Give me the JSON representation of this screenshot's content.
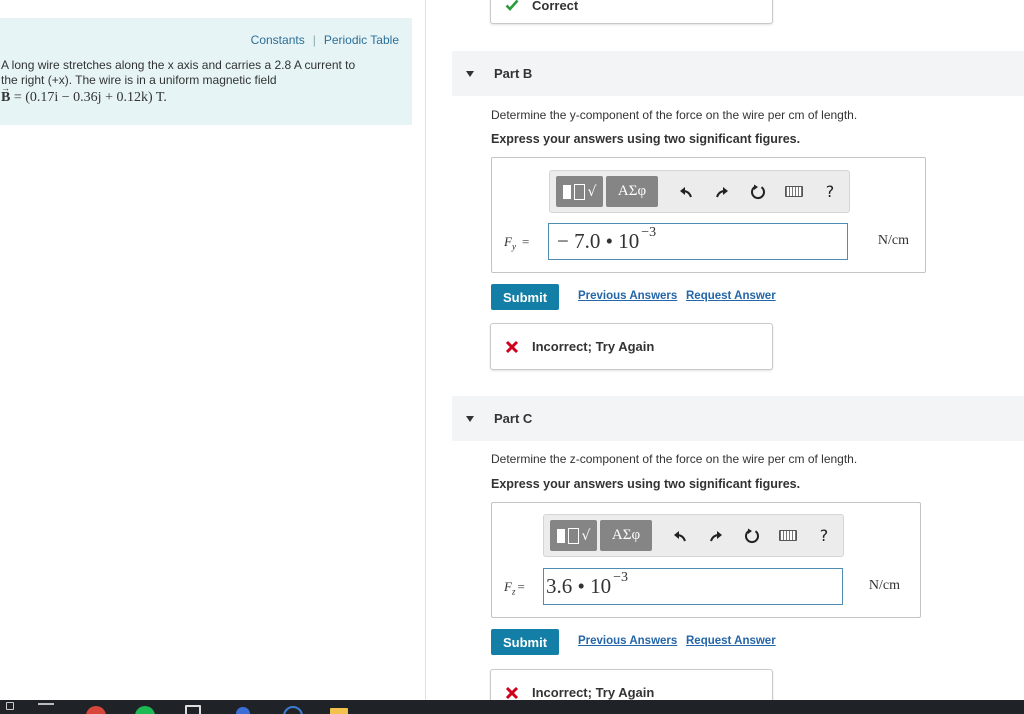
{
  "problem": {
    "links": {
      "constants": "Constants",
      "separator": "|",
      "periodic_table": "Periodic Table"
    },
    "text_line1": "A long wire stretches along the x axis and carries a 2.8 A current to",
    "text_line2": "the right (+x). The wire is in a uniform magnetic field",
    "field_symbol": "B",
    "field_value": " = (0.17i − 0.36j + 0.12k) T."
  },
  "part_a": {
    "feedback": "Correct",
    "feedback_icon": "check-icon",
    "color": "#2a9b3a"
  },
  "part_b": {
    "title": "Part B",
    "question": "Determine the y-component of the force on the wire per cm of length.",
    "instruction": "Express your answers using two significant figures.",
    "variable": "F",
    "variable_sub": "y",
    "equals": "=",
    "answer_mantissa": "− 7.0 • 10",
    "answer_exponent": "−3",
    "unit": "N/cm",
    "submit_label": "Submit",
    "previous_answers_label": "Previous Answers",
    "request_answer_label": "Request Answer",
    "feedback": "Incorrect; Try Again",
    "feedback_icon": "cross-icon"
  },
  "part_c": {
    "title": "Part C",
    "question": "Determine the z-component of the force on the wire per cm of length.",
    "instruction": "Express your answers using two significant figures.",
    "variable": "F",
    "variable_sub": "z",
    "equals": "=",
    "answer_mantissa": "3.6 • 10",
    "answer_exponent": "−3",
    "unit": "N/cm",
    "submit_label": "Submit",
    "previous_answers_label": "Previous Answers",
    "request_answer_label": "Request Answer",
    "feedback": "Incorrect; Try Again",
    "feedback_icon": "cross-icon"
  },
  "toolbar": {
    "greek_label": "ΑΣφ",
    "help_label": "?"
  },
  "colors": {
    "accent": "#137fa6",
    "link": "#2466a8",
    "error": "#d0021b",
    "correct": "#2a9b3a",
    "panel_bg": "#e6f4f6"
  }
}
